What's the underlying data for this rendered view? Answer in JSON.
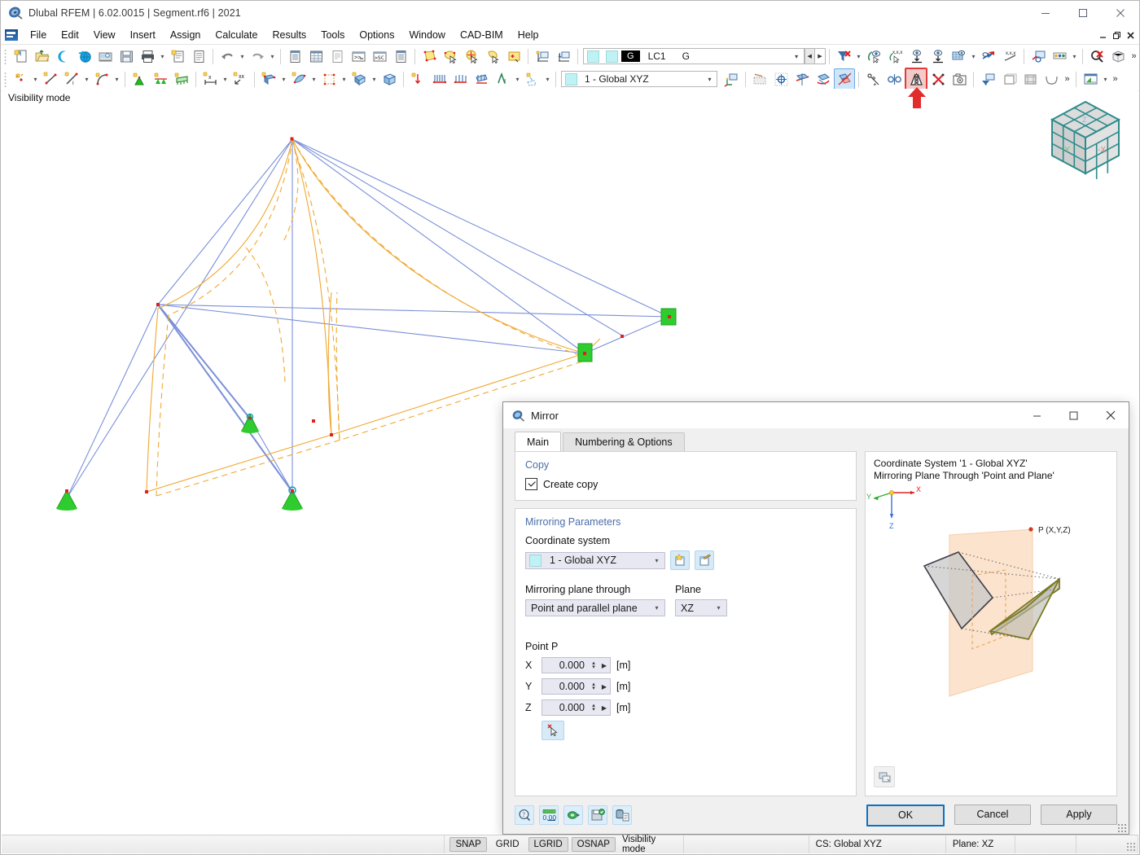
{
  "window": {
    "title": "Dlubal RFEM | 6.02.0015 | Segment.rf6 | 2021",
    "app_icon": "rfem-logo-icon",
    "minimize": "—",
    "maximize": "☐",
    "close": "✕"
  },
  "mdi": {
    "minimize": "–",
    "restore": "❐",
    "close": "✕"
  },
  "menu": {
    "items": [
      "File",
      "Edit",
      "View",
      "Insert",
      "Assign",
      "Calculate",
      "Results",
      "Tools",
      "Options",
      "Window",
      "CAD-BIM",
      "Help"
    ]
  },
  "toolbar_top": {
    "load_case": {
      "badge": "G",
      "code": "LC1",
      "name": "G"
    },
    "groups": [
      {
        "name": "file",
        "icons": [
          "new-model-icon",
          "open-folder-icon",
          "connect-icon",
          "dlubal-globe-icon",
          "print-preview-icon",
          "save-icon",
          "print-icon",
          "print-caret",
          "new-report-icon",
          "report-icon"
        ]
      },
      {
        "name": "undo",
        "icons": [
          "undo-icon",
          "undo-caret",
          "redo-icon",
          "redo-caret"
        ]
      },
      {
        "name": "tables",
        "icons": [
          "table-list-icon",
          "table-grid-icon",
          "table-report-icon",
          "console-icon",
          "script-sc-icon",
          "table-data-icon"
        ]
      },
      {
        "name": "select",
        "icons": [
          "select-surface-icon",
          "select-pick-icon",
          "select-circle-icon",
          "select-lasso-icon",
          "select-box-plus-icon"
        ]
      },
      {
        "name": "view",
        "icons": [
          "view-front-icon",
          "view-top-icon"
        ]
      }
    ]
  },
  "toolbar_right_top": {
    "icons": [
      "filter-clear-icon",
      "filter-caret",
      "visibility-icon",
      "visibility-xyz-icon",
      "lower-bound-icon",
      "upper-bound-icon",
      "grid-visibility-icon",
      "grid-caret",
      "section-view-icon",
      "section-xyz-icon",
      "render-mode-icon",
      "colors-icon",
      "colors-caret",
      "zoom-reset-icon",
      "box-view-icon"
    ],
    "overflow": "»"
  },
  "toolbar_second": {
    "coordinate_system": "1 - Global XYZ",
    "left_icons": [
      "node-icon",
      "node-caret",
      "line-icon",
      "line-diag-icon",
      "line-caret",
      "arc-icon",
      "arc-caret",
      "support-nodal-icon",
      "support-line-icon",
      "support-surface-icon",
      "dimension-icon",
      "dimension-caret",
      "dimension-xx-icon",
      "member-icon",
      "member-caret",
      "surface-icon",
      "surface-caret",
      "opening-icon",
      "opening-caret",
      "solid-icon",
      "solid-caret",
      "block-icon",
      "load-nodal-icon",
      "load-member-icon",
      "load-member2-icon",
      "load-surface-icon",
      "text-icon",
      "text-caret",
      "select-dashed-icon",
      "select-dashed-caret"
    ],
    "right_icons": [
      "cs-origin-icon",
      "work-plane-icon",
      "snap-center-icon",
      "move-icon",
      "rotate-icon",
      "mirror-active-icon",
      "scale-icon",
      "project-icon",
      "mirror-icon",
      "delete-cross-icon",
      "settings-cam-icon",
      "filter-panel-icon",
      "extrude-icon",
      "animation-icon",
      "curve-icon",
      "results-chart-icon",
      "results-caret"
    ],
    "highlighted_icon": "mirror-icon",
    "annotation": "red-arrow-up"
  },
  "viewport": {
    "visibility_label": "Visibility mode",
    "nav_cube": {
      "labels": [
        "-Y",
        "-X",
        "Z"
      ]
    }
  },
  "statusbar": {
    "toggles": [
      {
        "label": "SNAP",
        "active": true
      },
      {
        "label": "GRID",
        "active": false
      },
      {
        "label": "LGRID",
        "active": true
      },
      {
        "label": "OSNAP",
        "active": true
      }
    ],
    "mode": "Visibility mode",
    "cs": "CS: Global XYZ",
    "plane": "Plane: XZ"
  },
  "dialog": {
    "title": "Mirror",
    "icon": "mirror-dialog-icon",
    "controls": {
      "minimize": "—",
      "maximize": "☐",
      "close": "✕"
    },
    "tabs": [
      {
        "label": "Main",
        "active": true
      },
      {
        "label": "Numbering & Options",
        "active": false
      }
    ],
    "copy_group": {
      "title": "Copy",
      "checkbox_label": "Create copy",
      "checked": true
    },
    "mirroring_group": {
      "title": "Mirroring Parameters",
      "coordinate_system_label": "Coordinate system",
      "coordinate_system_value": "1 - Global XYZ",
      "new_cs_icon": "new-coordinate-system-icon",
      "edit_cs_icon": "edit-coordinate-system-icon",
      "plane_through_label": "Mirroring plane through",
      "plane_through_value": "Point and parallel plane",
      "plane_label": "Plane",
      "plane_value": "XZ",
      "point_label": "Point P",
      "pick_icon": "pick-point-cursor-icon",
      "coords": [
        {
          "axis": "X",
          "value": "0.000",
          "unit": "[m]"
        },
        {
          "axis": "Y",
          "value": "0.000",
          "unit": "[m]"
        },
        {
          "axis": "Z",
          "value": "0.000",
          "unit": "[m]"
        }
      ]
    },
    "preview": {
      "line1": "Coordinate System '1 - Global XYZ'",
      "line2": "Mirroring Plane Through 'Point and Plane'",
      "point_label": "P (X,Y,Z)",
      "axes": [
        "X",
        "Y",
        "Z"
      ],
      "snapshot_icon": "snapshot-icon"
    },
    "footer": {
      "tools": [
        "help-icon",
        "decimal-places-icon",
        "units-icon",
        "save-defaults-icon",
        "load-defaults-icon"
      ],
      "ok": "OK",
      "cancel": "Cancel",
      "apply": "Apply"
    }
  },
  "colors": {
    "accent_blue": "#0a72c4",
    "group_title": "#4a6ea9",
    "highlight_red": "#e13b3b",
    "member_blue": "#7a8fd8",
    "load_orange": "#f0a830",
    "support_green": "#22bb22",
    "node_red": "#e02020",
    "plane_fill": "#fbe3cd",
    "cube_teal": "#2e8b8b"
  }
}
